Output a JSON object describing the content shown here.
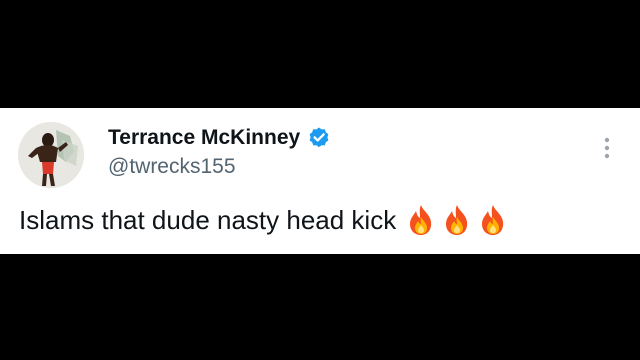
{
  "tweet": {
    "author": {
      "display_name": "Terrance McKinney",
      "handle": "@twrecks155",
      "verified": true,
      "avatar_icon": "profile-photo"
    },
    "text": "Islams that dude nasty head kick",
    "emoji": [
      "fire-icon",
      "fire-icon",
      "fire-icon"
    ],
    "more_icon": "more-vertical-icon"
  },
  "colors": {
    "background": "#000000",
    "card": "#ffffff",
    "text_primary": "#0f1419",
    "text_secondary": "#536471",
    "verified_blue": "#1d9bf0"
  }
}
